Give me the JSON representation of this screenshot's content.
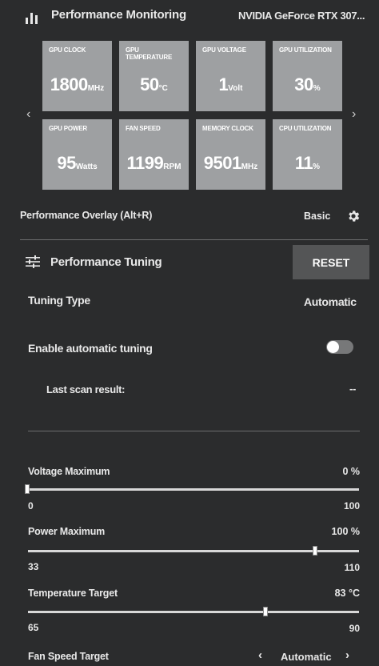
{
  "header": {
    "title": "Performance Monitoring",
    "gpu_name": "NVIDIA GeForce RTX 307..."
  },
  "tiles": [
    {
      "label": "GPU CLOCK",
      "value": "1800",
      "unit": "MHz"
    },
    {
      "label": "GPU TEMPERATURE",
      "value": "50",
      "unit": "°C"
    },
    {
      "label": "GPU VOLTAGE",
      "value": "1",
      "unit": "Volt"
    },
    {
      "label": "GPU UTILIZATION",
      "value": "30",
      "unit": "%"
    },
    {
      "label": "GPU POWER",
      "value": "95",
      "unit": "Watts"
    },
    {
      "label": "FAN SPEED",
      "value": "1199",
      "unit": "RPM"
    },
    {
      "label": "MEMORY CLOCK",
      "value": "9501",
      "unit": "MHz"
    },
    {
      "label": "CPU UTILIZATION",
      "value": "11",
      "unit": "%"
    }
  ],
  "nav": {
    "prev": "‹",
    "next": "›"
  },
  "overlay": {
    "label": "Performance Overlay (Alt+R)",
    "value": "Basic"
  },
  "tuning": {
    "title": "Performance Tuning",
    "reset_label": "RESET",
    "type_label": "Tuning Type",
    "type_value": "Automatic",
    "auto_label": "Enable automatic tuning",
    "auto_enabled": false,
    "scan_label": "Last scan result:",
    "scan_value": "--"
  },
  "sliders": [
    {
      "label": "Voltage Maximum",
      "value_text": "0 %",
      "min": "0",
      "max": "100",
      "level": 0
    },
    {
      "label": "Power Maximum",
      "value_text": "100 %",
      "min": "33",
      "max": "110",
      "level": 0.87
    },
    {
      "label": "Temperature Target",
      "value_text": "83 °C",
      "min": "65",
      "max": "90",
      "level": 0.72
    }
  ],
  "fan": {
    "label": "Fan Speed Target",
    "value": "Automatic",
    "prev": "‹",
    "next": "›"
  },
  "colors": {
    "tile_bg": "#9ea0a2",
    "page_bg": "#2b2c2d",
    "reset_bg": "#545556"
  }
}
